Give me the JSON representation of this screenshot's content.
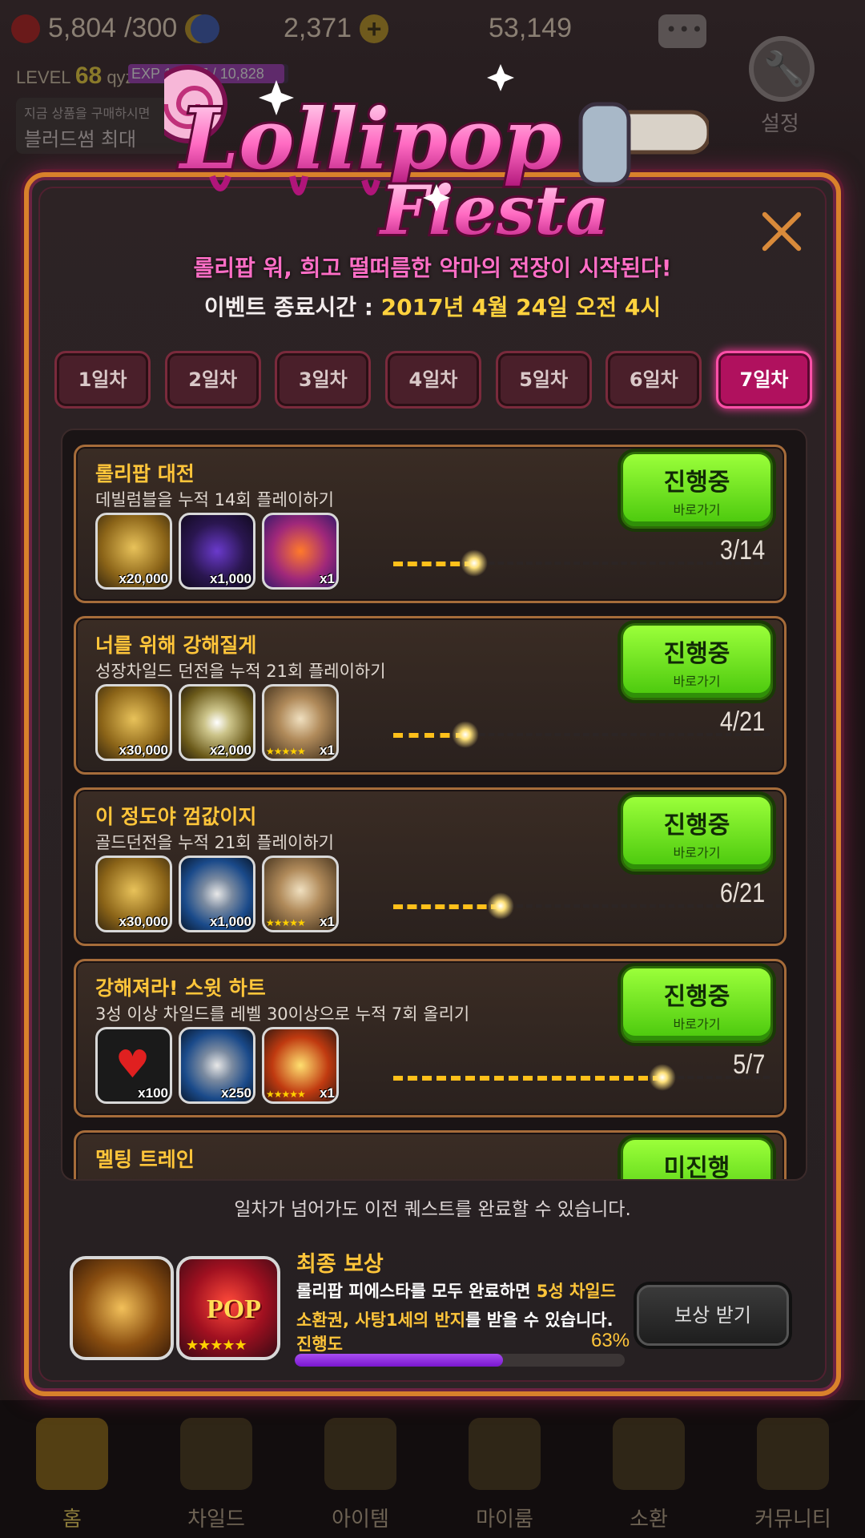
{
  "hud": {
    "hearts": "5,804",
    "hearts_max": "/300",
    "gems": "2,371",
    "gold": "53,149",
    "level_label": "LEVEL",
    "level": "68",
    "username": "qyz",
    "exp_text": "EXP 10,567 / 10,828",
    "exp_progress": 0.976,
    "promo_line1": "지금 상품을 구매하시면",
    "promo_line2": "블러드썸 최대",
    "settings_label": "설정"
  },
  "event": {
    "logo_line1": "Lollipop",
    "logo_line2": "Fiesta",
    "subtitle": "롤리팝 워, 희고 떨떠름한 악마의 전장이 시작된다!",
    "end_time_label": "이벤트 종료시간 : ",
    "end_time_value": "2017년 4월 24일 오전 4시",
    "day_tabs": [
      "1일차",
      "2일차",
      "3일차",
      "4일차",
      "5일차",
      "6일차",
      "7일차"
    ],
    "active_day": 7
  },
  "quests": [
    {
      "title": "롤리팝 대전",
      "desc": "데빌럼블을 누적 14회 플레이하기",
      "rewards": [
        {
          "type": "gold",
          "qty": "x20,000"
        },
        {
          "type": "gem",
          "qty": "x1,000"
        },
        {
          "type": "pet",
          "qty": "x1"
        }
      ],
      "progress": "3/14",
      "status": "진행중",
      "action": "바로가기"
    },
    {
      "title": "너를 위해 강해질게",
      "desc": "성장차일드 던전을 누적 21회 플레이하기",
      "rewards": [
        {
          "type": "gold",
          "qty": "x30,000"
        },
        {
          "type": "coin",
          "qty": "x2,000"
        },
        {
          "type": "ring",
          "qty": "x1"
        }
      ],
      "progress": "4/21",
      "status": "진행중",
      "action": "바로가기"
    },
    {
      "title": "이 정도야 껌값이지",
      "desc": "골드던전을 누적 21회 플레이하기",
      "rewards": [
        {
          "type": "gold",
          "qty": "x30,000"
        },
        {
          "type": "blue",
          "qty": "x1,000"
        },
        {
          "type": "ring",
          "qty": "x1"
        }
      ],
      "progress": "6/21",
      "status": "진행중",
      "action": "바로가기"
    },
    {
      "title": "강해져라! 스윗 하트",
      "desc": "3성 이상 차일드를 레벨 30이상으로 누적 7회 올리기",
      "rewards": [
        {
          "type": "heart",
          "qty": "x100"
        },
        {
          "type": "blue",
          "qty": "x250"
        },
        {
          "type": "chest",
          "qty": "x1"
        }
      ],
      "progress": "5/7",
      "status": "진행중",
      "action": "바로가기"
    },
    {
      "title": "멜팅 트레인",
      "desc": "",
      "rewards": [],
      "progress": "",
      "status": "미진행",
      "action": ""
    }
  ],
  "notice": "일차가 넘어가도 이전 퀘스트를 완료할 수 있습니다.",
  "final_reward": {
    "title": "최종 보상",
    "desc_a": "롤리팝 피에스타를 모두 완료하면 ",
    "desc_hl1": "5성 차일드",
    "desc_hl2": "소환권, 사탕1세의 반지",
    "desc_b": "를 받을 수 있습니다.",
    "progress_label": "진행도",
    "progress_pct": "63%",
    "progress_value": 0.63,
    "ring_text": "POP",
    "claim_label": "보상 받기"
  },
  "bottom_nav": [
    "홈",
    "차일드",
    "아이템",
    "마이룸",
    "소환",
    "커뮤니티"
  ],
  "colors": {
    "accent_pink": "#ff6ec6",
    "gold_text": "#ffc53a",
    "status_green": "#7be023",
    "progress_purple": "#8d2ae0"
  }
}
